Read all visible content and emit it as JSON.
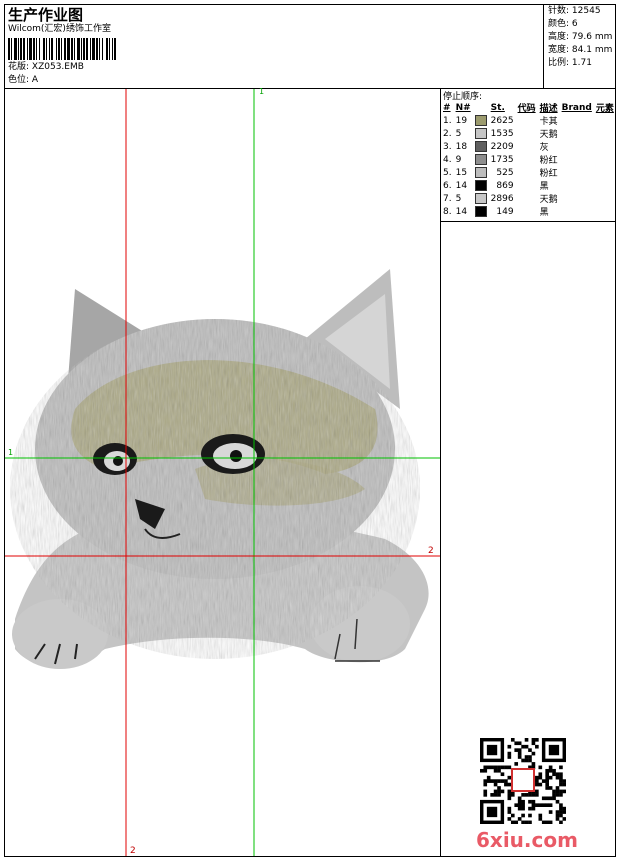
{
  "header": {
    "title": "生产作业图",
    "company": "Wilcom(汇宏)绣饰工作室",
    "design_label": "花版:",
    "design_value": "XZ053.EMB",
    "colorway_label": "色位:",
    "colorway_value": "A"
  },
  "stats": [
    {
      "label": "针数:",
      "value": "12545"
    },
    {
      "label": "颜色:",
      "value": "6"
    },
    {
      "label": "高度:",
      "value": "79.6 mm"
    },
    {
      "label": "宽度:",
      "value": "84.1 mm"
    },
    {
      "label": "比例:",
      "value": "1.71"
    }
  ],
  "stops": {
    "title": "停止顺序:",
    "headers": [
      "#",
      "N#",
      "St.",
      "代码",
      "描述",
      "Brand",
      "元素"
    ],
    "rows": [
      {
        "idx": "1.",
        "n": "19",
        "color": "#9c9b6e",
        "st": "2625",
        "desc": "卡其"
      },
      {
        "idx": "2.",
        "n": "5",
        "color": "#c6c6c6",
        "st": "1535",
        "desc": "天鹅"
      },
      {
        "idx": "3.",
        "n": "18",
        "color": "#5f5f5f",
        "st": "2209",
        "desc": "灰"
      },
      {
        "idx": "4.",
        "n": "9",
        "color": "#8e8e8e",
        "st": "1735",
        "desc": "粉红"
      },
      {
        "idx": "5.",
        "n": "15",
        "color": "#bdbdbd",
        "st": "525",
        "desc": "粉红"
      },
      {
        "idx": "6.",
        "n": "14",
        "color": "#000000",
        "st": "869",
        "desc": "黑"
      },
      {
        "idx": "7.",
        "n": "5",
        "color": "#c8c8c8",
        "st": "2896",
        "desc": "天鹅"
      },
      {
        "idx": "8.",
        "n": "14",
        "color": "#000000",
        "st": "149",
        "desc": "黑"
      }
    ]
  },
  "guides": {
    "green_top": "1",
    "green_left": "1",
    "red_right": "2",
    "red_bottom": "2"
  },
  "watermark": "6xiu.com"
}
